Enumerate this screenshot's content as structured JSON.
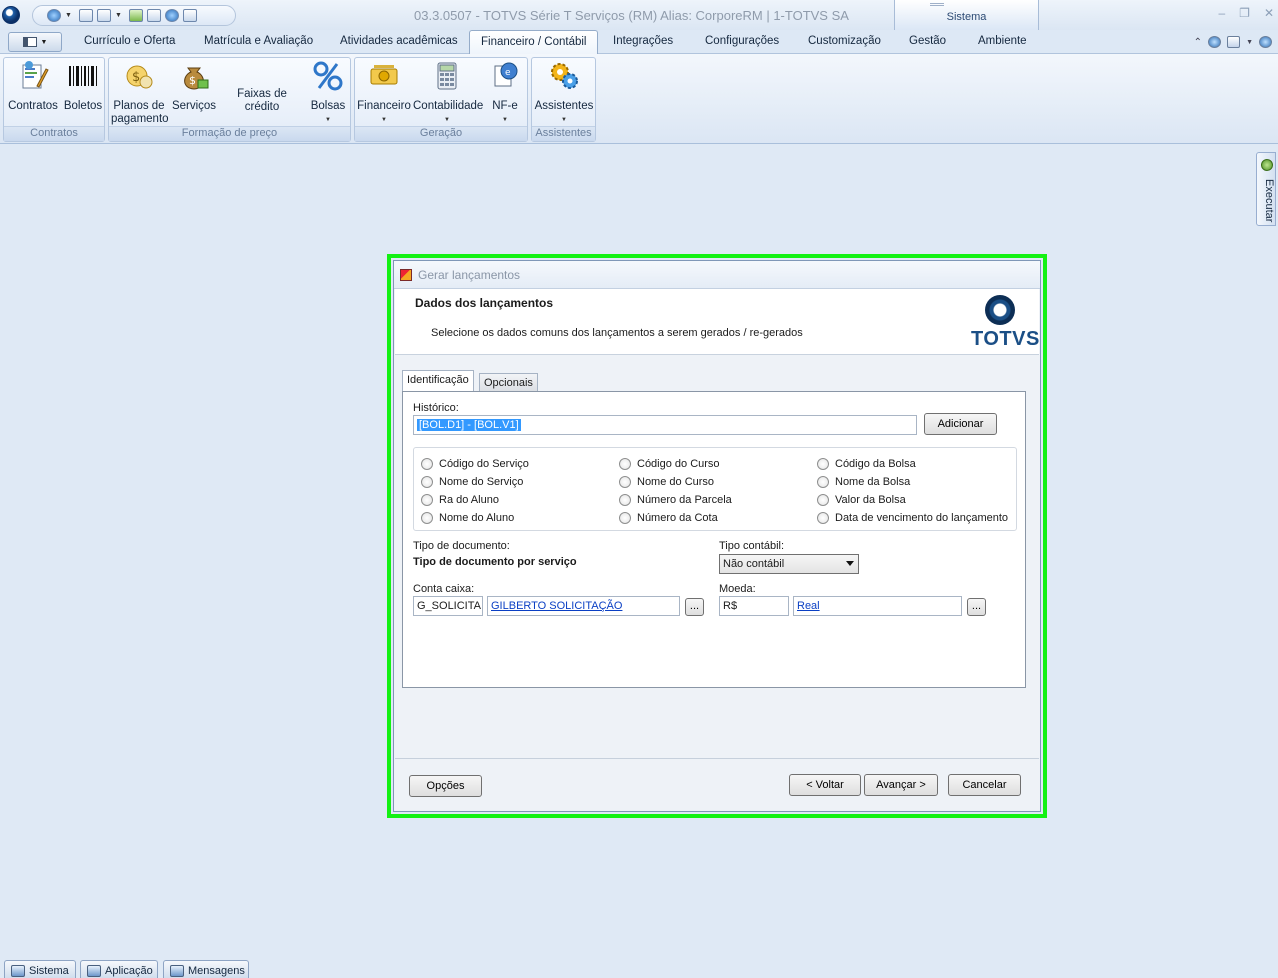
{
  "window": {
    "title": "03.3.0507 - TOTVS Série T Serviços (RM) Alias: CorporeRM | 1-TOTVS SA",
    "context_group": "Sistema",
    "controls": [
      "–",
      "❐",
      "✕"
    ]
  },
  "ribbon_tabs": [
    "Currículo e Oferta",
    "Matrícula e Avaliação",
    "Atividades acadêmicas",
    "Financeiro / Contábil",
    "Integrações",
    "Configurações",
    "Customização",
    "Gestão",
    "Ambiente"
  ],
  "active_tab": "Financeiro / Contábil",
  "ribbon": {
    "groups": {
      "contratos": "Contratos",
      "formacao": "Formação de preço",
      "geracao": "Geração",
      "assistentes": "Assistentes"
    },
    "buttons": {
      "contratos": "Contratos",
      "boletos": "Boletos",
      "planos_l1": "Planos de",
      "planos_l2": "pagamento",
      "servicos": "Serviços",
      "faixas": "Faixas de crédito",
      "bolsas": "Bolsas",
      "financeiro": "Financeiro",
      "contabilidade": "Contabilidade",
      "nfe": "NF-e",
      "assistentes": "Assistentes"
    },
    "icons": {
      "contratos": "document-pen-icon",
      "boletos": "barcode-icon",
      "planos": "payment-plan-icon",
      "servicos": "money-bag-icon",
      "bolsas": "percent-icon",
      "financeiro": "money-icon",
      "contabilidade": "calculator-icon",
      "nfe": "nfe-icon",
      "assistentes": "gears-icon"
    }
  },
  "side_panel": {
    "execute_label": "Executar"
  },
  "dialog": {
    "caption": "Gerar lançamentos",
    "header_title": "Dados dos lançamentos",
    "header_subtitle": "Selecione os dados comuns dos lançamentos a serem gerados / re-gerados",
    "logo_text": "TOTVS",
    "tabs": [
      "Identificação",
      "Opcionais"
    ],
    "active_tab": "Identificação",
    "historico": {
      "label": "Histórico:",
      "value": "[BOL.D1] - [BOL.V1]",
      "add_button": "Adicionar"
    },
    "radio_options": [
      [
        "Código do Serviço",
        "Nome do Serviço",
        "Ra do Aluno",
        "Nome do Aluno"
      ],
      [
        "Código do Curso",
        "Nome do Curso",
        "Número da Parcela",
        "Número da Cota"
      ],
      [
        "Código da Bolsa",
        "Nome da Bolsa",
        "Valor da Bolsa",
        "Data de vencimento do lançamento"
      ]
    ],
    "tipo_documento": {
      "label": "Tipo de documento:",
      "value": "Tipo de documento por serviço"
    },
    "tipo_contabil": {
      "label": "Tipo contábil:",
      "value": "Não contábil"
    },
    "conta_caixa": {
      "label": "Conta caixa:",
      "code": "G_SOLICITA",
      "name": "GILBERTO SOLICITAÇÃO",
      "lookup": "..."
    },
    "moeda": {
      "label": "Moeda:",
      "code": "R$",
      "name": "Real",
      "lookup": "..."
    },
    "buttons": {
      "options": "Opções",
      "back": "< Voltar",
      "next": "Avançar >",
      "cancel": "Cancelar"
    }
  },
  "bottom_tabs": [
    "Sistema",
    "Aplicação",
    "Mensagens"
  ],
  "colors": {
    "highlight_outline": "#13f113",
    "link": "#0a3fc4",
    "selection": "#3399ff"
  }
}
